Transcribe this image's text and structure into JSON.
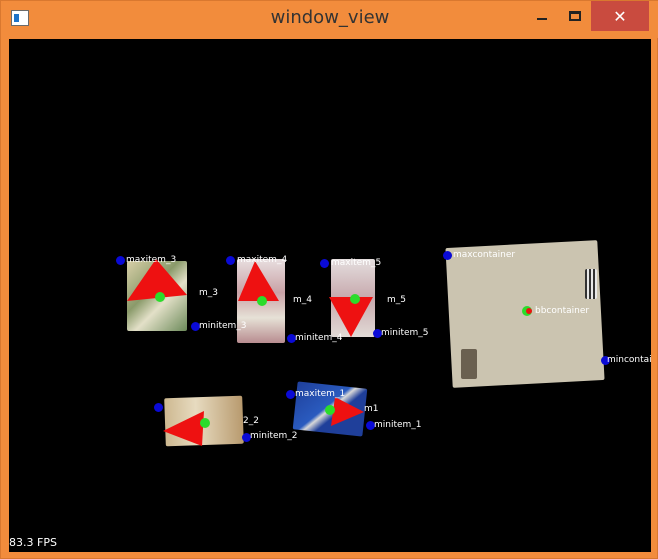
{
  "window": {
    "title": "window_view",
    "minimize_label": "—",
    "maximize_label": "",
    "close_label": "✕"
  },
  "viewport": {
    "fps": "83.3 FPS"
  },
  "labels": {
    "maxitem_3": "maxitem_3",
    "bbitem_3": "m_3",
    "minitem_3": "minitem_3",
    "maxitem_4": "maxitem_4",
    "bbitem_4": "m_4",
    "minitem_4": "minitem_4",
    "maxitem_5": "maxitem_5",
    "bbitem_5": "m_5",
    "minitem_5": "minitem_5",
    "maxcontainer": "maxcontainer",
    "bbcontainer": "bbcontainer",
    "mincontainer": "mincontai",
    "item_2": "2_2",
    "minitem_2": "minitem_2",
    "maxitem_1": "maxitem_1",
    "item_1": "m1",
    "minitem_1": "minitem_1"
  },
  "colors": {
    "window_border": "#f28c3c",
    "close_button": "#c94b3f",
    "viewport_bg": "#000000",
    "corner_point": "#0a0ad6",
    "center_point": "#2bdc2b",
    "arrow": "#ee1111",
    "container_surface": "#c9c2ae"
  },
  "icons": {
    "app": "window-app-icon",
    "minimize": "minimize-icon",
    "maximize": "maximize-icon",
    "close": "close-icon"
  }
}
